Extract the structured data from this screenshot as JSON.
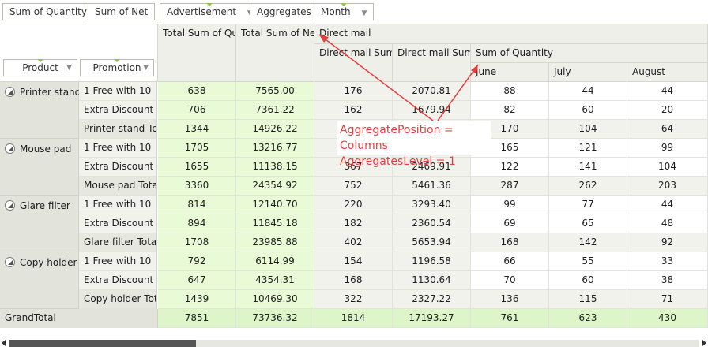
{
  "field_chips": {
    "data_fields": [
      "Sum of Quantity",
      "Sum of Net"
    ],
    "column_fields": [
      "Advertisement",
      "Aggregates",
      "Month"
    ]
  },
  "row_fields": [
    "Product",
    "Promotion"
  ],
  "column_headers": {
    "total_quantity": "Total Sum of Qu",
    "total_net": "Total Sum of Ne",
    "direct_mail": "Direct mail",
    "dm_sum_1": "Direct mail Sum",
    "dm_sum_2": "Direct mail Sum",
    "sum_of_quantity": "Sum of Quantity",
    "months": [
      "June",
      "July",
      "August"
    ]
  },
  "products": [
    {
      "name": "Printer stand",
      "rows": [
        {
          "promotion": "1 Free with 10",
          "cells": [
            "638",
            "7565.00",
            "176",
            "2070.81",
            "88",
            "44",
            "44"
          ]
        },
        {
          "promotion": "Extra Discount",
          "cells": [
            "706",
            "7361.22",
            "162",
            "1679.94",
            "82",
            "60",
            "20"
          ]
        },
        {
          "promotion": "Printer stand To",
          "cells": [
            "1344",
            "14926.22",
            "",
            "",
            "170",
            "104",
            "64"
          ]
        }
      ]
    },
    {
      "name": "Mouse pad",
      "rows": [
        {
          "promotion": "1 Free with 10",
          "cells": [
            "1705",
            "13216.77",
            "",
            "",
            "165",
            "121",
            "99"
          ]
        },
        {
          "promotion": "Extra Discount",
          "cells": [
            "1655",
            "11138.15",
            "367",
            "2469.91",
            "122",
            "141",
            "104"
          ]
        },
        {
          "promotion": "Mouse pad Tota",
          "cells": [
            "3360",
            "24354.92",
            "752",
            "5461.36",
            "287",
            "262",
            "203"
          ]
        }
      ]
    },
    {
      "name": "Glare filter",
      "rows": [
        {
          "promotion": "1 Free with 10",
          "cells": [
            "814",
            "12140.70",
            "220",
            "3293.40",
            "99",
            "77",
            "44"
          ]
        },
        {
          "promotion": "Extra Discount",
          "cells": [
            "894",
            "11845.18",
            "182",
            "2360.54",
            "69",
            "65",
            "48"
          ]
        },
        {
          "promotion": "Glare filter Total",
          "cells": [
            "1708",
            "23985.88",
            "402",
            "5653.94",
            "168",
            "142",
            "92"
          ]
        }
      ]
    },
    {
      "name": "Copy holder",
      "rows": [
        {
          "promotion": "1 Free with 10",
          "cells": [
            "792",
            "6114.99",
            "154",
            "1196.58",
            "66",
            "55",
            "33"
          ]
        },
        {
          "promotion": "Extra Discount",
          "cells": [
            "647",
            "4354.31",
            "168",
            "1130.64",
            "70",
            "60",
            "38"
          ]
        },
        {
          "promotion": "Copy holder Tot",
          "cells": [
            "1439",
            "10469.30",
            "322",
            "2327.22",
            "136",
            "115",
            "71"
          ]
        }
      ]
    }
  ],
  "grand_total": {
    "label": "GrandTotal",
    "cells": [
      "7851",
      "73736.32",
      "1814",
      "17193.27",
      "761",
      "623",
      "430"
    ]
  },
  "annotation": {
    "line1": "AggregatePosition = Columns",
    "line2": "AggregatesLevel = 1",
    "color": "#e53e3e"
  },
  "icons": {
    "filter": "funnel-icon",
    "collapse": "collapse-toggle-icon",
    "sort": "sort-indicator-icon"
  },
  "colors": {
    "total_green": "#e9fbd6",
    "header_bg": "#eeefe8",
    "sort_accent": "#8fc341"
  }
}
